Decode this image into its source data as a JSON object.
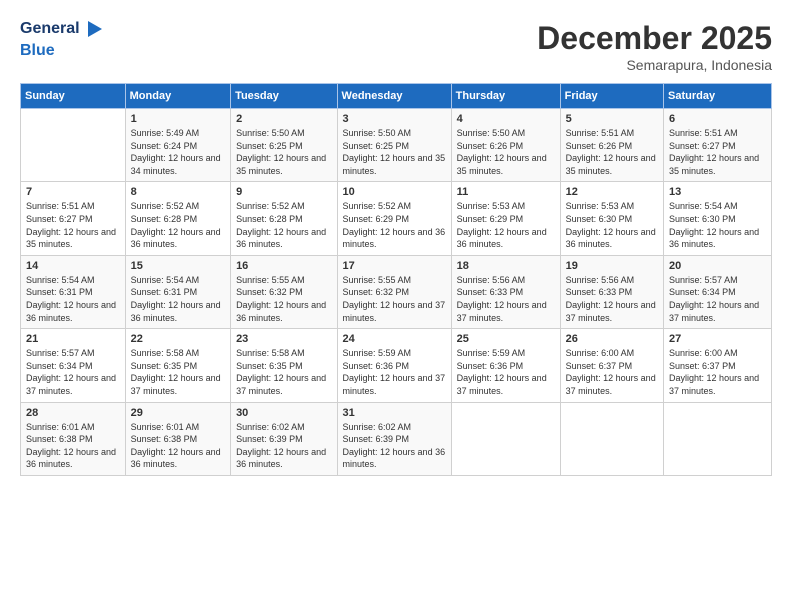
{
  "logo": {
    "line1": "General",
    "line2": "Blue"
  },
  "title": "December 2025",
  "subtitle": "Semarapura, Indonesia",
  "days_header": [
    "Sunday",
    "Monday",
    "Tuesday",
    "Wednesday",
    "Thursday",
    "Friday",
    "Saturday"
  ],
  "weeks": [
    [
      {
        "num": "",
        "sunrise": "",
        "sunset": "",
        "daylight": ""
      },
      {
        "num": "1",
        "sunrise": "Sunrise: 5:49 AM",
        "sunset": "Sunset: 6:24 PM",
        "daylight": "Daylight: 12 hours and 34 minutes."
      },
      {
        "num": "2",
        "sunrise": "Sunrise: 5:50 AM",
        "sunset": "Sunset: 6:25 PM",
        "daylight": "Daylight: 12 hours and 35 minutes."
      },
      {
        "num": "3",
        "sunrise": "Sunrise: 5:50 AM",
        "sunset": "Sunset: 6:25 PM",
        "daylight": "Daylight: 12 hours and 35 minutes."
      },
      {
        "num": "4",
        "sunrise": "Sunrise: 5:50 AM",
        "sunset": "Sunset: 6:26 PM",
        "daylight": "Daylight: 12 hours and 35 minutes."
      },
      {
        "num": "5",
        "sunrise": "Sunrise: 5:51 AM",
        "sunset": "Sunset: 6:26 PM",
        "daylight": "Daylight: 12 hours and 35 minutes."
      },
      {
        "num": "6",
        "sunrise": "Sunrise: 5:51 AM",
        "sunset": "Sunset: 6:27 PM",
        "daylight": "Daylight: 12 hours and 35 minutes."
      }
    ],
    [
      {
        "num": "7",
        "sunrise": "Sunrise: 5:51 AM",
        "sunset": "Sunset: 6:27 PM",
        "daylight": "Daylight: 12 hours and 35 minutes."
      },
      {
        "num": "8",
        "sunrise": "Sunrise: 5:52 AM",
        "sunset": "Sunset: 6:28 PM",
        "daylight": "Daylight: 12 hours and 36 minutes."
      },
      {
        "num": "9",
        "sunrise": "Sunrise: 5:52 AM",
        "sunset": "Sunset: 6:28 PM",
        "daylight": "Daylight: 12 hours and 36 minutes."
      },
      {
        "num": "10",
        "sunrise": "Sunrise: 5:52 AM",
        "sunset": "Sunset: 6:29 PM",
        "daylight": "Daylight: 12 hours and 36 minutes."
      },
      {
        "num": "11",
        "sunrise": "Sunrise: 5:53 AM",
        "sunset": "Sunset: 6:29 PM",
        "daylight": "Daylight: 12 hours and 36 minutes."
      },
      {
        "num": "12",
        "sunrise": "Sunrise: 5:53 AM",
        "sunset": "Sunset: 6:30 PM",
        "daylight": "Daylight: 12 hours and 36 minutes."
      },
      {
        "num": "13",
        "sunrise": "Sunrise: 5:54 AM",
        "sunset": "Sunset: 6:30 PM",
        "daylight": "Daylight: 12 hours and 36 minutes."
      }
    ],
    [
      {
        "num": "14",
        "sunrise": "Sunrise: 5:54 AM",
        "sunset": "Sunset: 6:31 PM",
        "daylight": "Daylight: 12 hours and 36 minutes."
      },
      {
        "num": "15",
        "sunrise": "Sunrise: 5:54 AM",
        "sunset": "Sunset: 6:31 PM",
        "daylight": "Daylight: 12 hours and 36 minutes."
      },
      {
        "num": "16",
        "sunrise": "Sunrise: 5:55 AM",
        "sunset": "Sunset: 6:32 PM",
        "daylight": "Daylight: 12 hours and 36 minutes."
      },
      {
        "num": "17",
        "sunrise": "Sunrise: 5:55 AM",
        "sunset": "Sunset: 6:32 PM",
        "daylight": "Daylight: 12 hours and 37 minutes."
      },
      {
        "num": "18",
        "sunrise": "Sunrise: 5:56 AM",
        "sunset": "Sunset: 6:33 PM",
        "daylight": "Daylight: 12 hours and 37 minutes."
      },
      {
        "num": "19",
        "sunrise": "Sunrise: 5:56 AM",
        "sunset": "Sunset: 6:33 PM",
        "daylight": "Daylight: 12 hours and 37 minutes."
      },
      {
        "num": "20",
        "sunrise": "Sunrise: 5:57 AM",
        "sunset": "Sunset: 6:34 PM",
        "daylight": "Daylight: 12 hours and 37 minutes."
      }
    ],
    [
      {
        "num": "21",
        "sunrise": "Sunrise: 5:57 AM",
        "sunset": "Sunset: 6:34 PM",
        "daylight": "Daylight: 12 hours and 37 minutes."
      },
      {
        "num": "22",
        "sunrise": "Sunrise: 5:58 AM",
        "sunset": "Sunset: 6:35 PM",
        "daylight": "Daylight: 12 hours and 37 minutes."
      },
      {
        "num": "23",
        "sunrise": "Sunrise: 5:58 AM",
        "sunset": "Sunset: 6:35 PM",
        "daylight": "Daylight: 12 hours and 37 minutes."
      },
      {
        "num": "24",
        "sunrise": "Sunrise: 5:59 AM",
        "sunset": "Sunset: 6:36 PM",
        "daylight": "Daylight: 12 hours and 37 minutes."
      },
      {
        "num": "25",
        "sunrise": "Sunrise: 5:59 AM",
        "sunset": "Sunset: 6:36 PM",
        "daylight": "Daylight: 12 hours and 37 minutes."
      },
      {
        "num": "26",
        "sunrise": "Sunrise: 6:00 AM",
        "sunset": "Sunset: 6:37 PM",
        "daylight": "Daylight: 12 hours and 37 minutes."
      },
      {
        "num": "27",
        "sunrise": "Sunrise: 6:00 AM",
        "sunset": "Sunset: 6:37 PM",
        "daylight": "Daylight: 12 hours and 37 minutes."
      }
    ],
    [
      {
        "num": "28",
        "sunrise": "Sunrise: 6:01 AM",
        "sunset": "Sunset: 6:38 PM",
        "daylight": "Daylight: 12 hours and 36 minutes."
      },
      {
        "num": "29",
        "sunrise": "Sunrise: 6:01 AM",
        "sunset": "Sunset: 6:38 PM",
        "daylight": "Daylight: 12 hours and 36 minutes."
      },
      {
        "num": "30",
        "sunrise": "Sunrise: 6:02 AM",
        "sunset": "Sunset: 6:39 PM",
        "daylight": "Daylight: 12 hours and 36 minutes."
      },
      {
        "num": "31",
        "sunrise": "Sunrise: 6:02 AM",
        "sunset": "Sunset: 6:39 PM",
        "daylight": "Daylight: 12 hours and 36 minutes."
      },
      {
        "num": "",
        "sunrise": "",
        "sunset": "",
        "daylight": ""
      },
      {
        "num": "",
        "sunrise": "",
        "sunset": "",
        "daylight": ""
      },
      {
        "num": "",
        "sunrise": "",
        "sunset": "",
        "daylight": ""
      }
    ]
  ]
}
